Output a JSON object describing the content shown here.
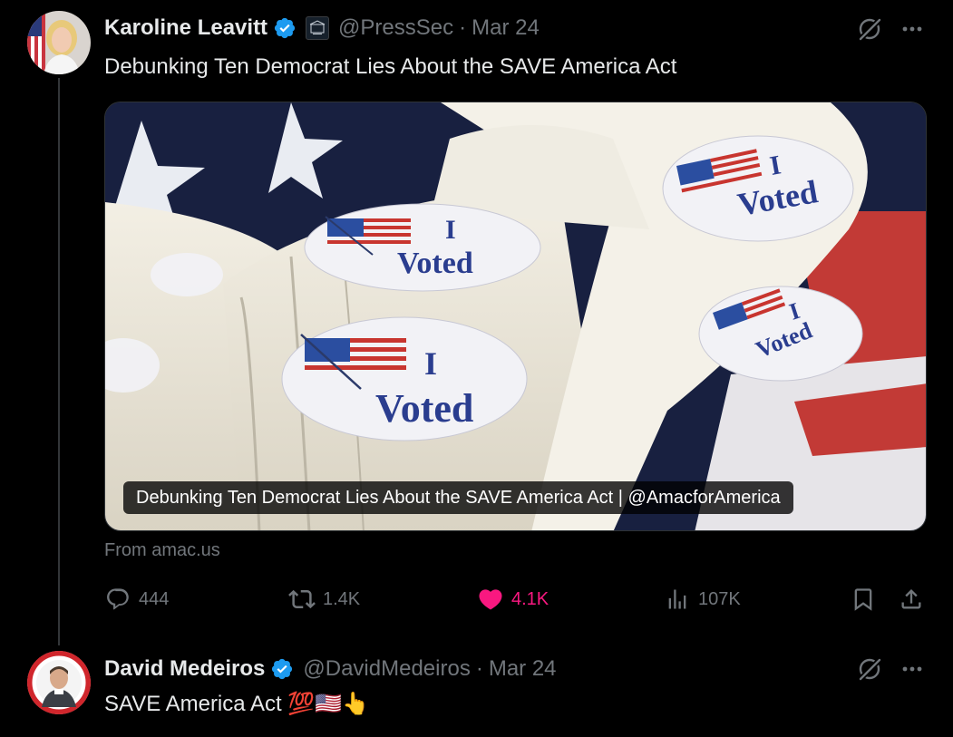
{
  "posts": [
    {
      "author": {
        "display_name": "Karoline Leavitt",
        "handle": "@PressSec",
        "verified": true,
        "affiliation_badge": "white-house-badge"
      },
      "date": "Mar 24",
      "text": "Debunking Ten Democrat Lies About the SAVE America Act",
      "link_card": {
        "image": "i-voted-stickers-photo",
        "image_texts": [
          "I",
          "Voted"
        ],
        "caption": "Debunking Ten Democrat Lies About the SAVE America Act | @AmacforAmerica",
        "source": "From amac.us"
      },
      "metrics": {
        "replies": "444",
        "reposts": "1.4K",
        "likes": "4.1K",
        "views": "107K"
      },
      "liked": true
    },
    {
      "author": {
        "display_name": "David Medeiros",
        "handle": "@DavidMedeiros",
        "verified": true
      },
      "date": "Mar 24",
      "text": "SAVE America Act 💯🇺🇸👆"
    }
  ],
  "separator": "·",
  "colors": {
    "background": "#000000",
    "text_primary": "#e7e9ea",
    "text_secondary": "#71767b",
    "verified_blue": "#1d9bf0",
    "like_pink": "#f91880"
  },
  "icons": [
    "grok-icon",
    "more-icon",
    "reply-icon",
    "repost-icon",
    "heart-icon",
    "views-icon",
    "bookmark-icon",
    "share-icon"
  ]
}
